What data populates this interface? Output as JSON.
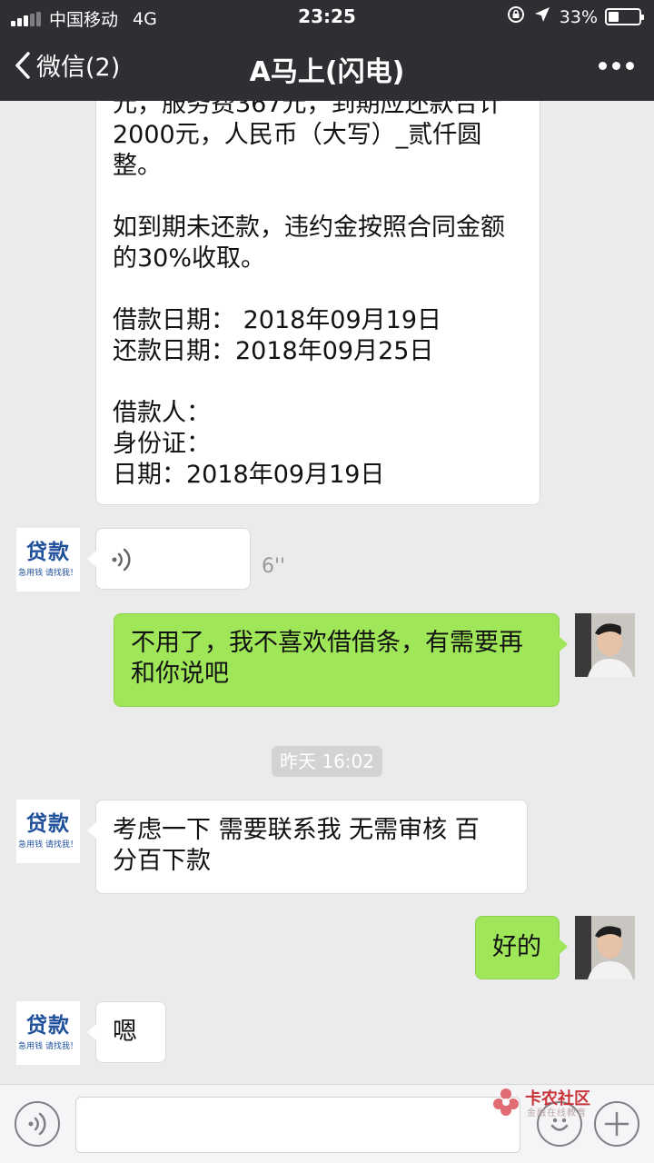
{
  "status_bar": {
    "carrier": "中国移动",
    "network": "4G",
    "time": "23:25",
    "battery": "33%",
    "battery_level": 0.33
  },
  "nav": {
    "back_label": "微信(2)",
    "title": "A马上(闪电)"
  },
  "contact_avatar": {
    "line1": "贷款",
    "line2": "急用钱 请找我！"
  },
  "messages": {
    "contract": {
      "partial_line": "元，服务费367元，到期应还款合计",
      "text": "2000元，人民币（大写）_贰仟圆\n整。\n\n如到期未还款，违约金按照合同金额\n的30%收取。\n\n借款日期： 2018年09月19日\n还款日期：2018年09月25日\n\n借款人：\n身份证：\n日期：2018年09月19日"
    },
    "voice_duration": "6''",
    "reply1": "不用了，我不喜欢借借条，有需要再\n和你说吧",
    "timestamp": "昨天 16:02",
    "msg2": "考虑一下  需要联系我   无需审核 百\n分百下款",
    "reply2": "好的",
    "msg3": "嗯"
  },
  "input": {
    "value": ""
  },
  "watermark": {
    "title": "卡农社区",
    "subtitle": "金融在线教育"
  }
}
